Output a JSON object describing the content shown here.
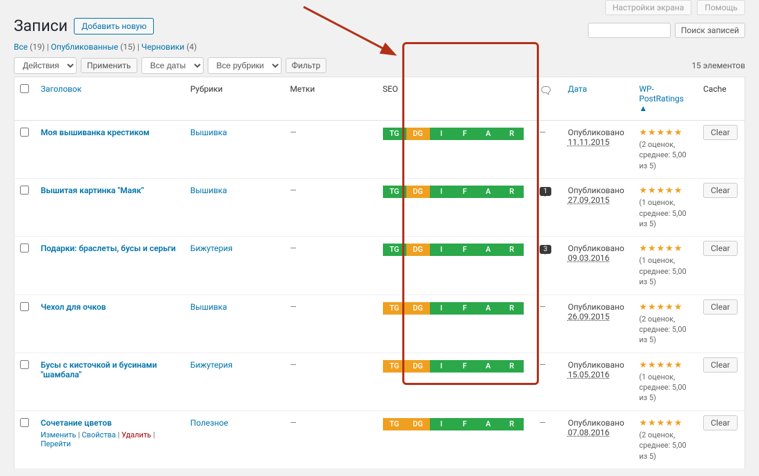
{
  "screen_opts": "Настройки экрана",
  "help": "Помощь",
  "page_title": "Записи",
  "add_new": "Добавить новую",
  "views": {
    "all_label": "Все",
    "all_count": "(19)",
    "pub_label": "Опубликованные",
    "pub_count": "(15)",
    "draft_label": "Черновики",
    "draft_count": "(4)"
  },
  "search": {
    "placeholder": "",
    "btn": "Поиск записей"
  },
  "bulk": {
    "actions": "Действия",
    "apply": "Применить"
  },
  "filters": {
    "all_dates": "Все даты",
    "all_cats": "Все рубрики",
    "filter": "Фильтр"
  },
  "count_items": "15 элементов",
  "columns": {
    "title": "Заголовок",
    "cats": "Рубрики",
    "tags": "Метки",
    "seo": "SEO",
    "date": "Дата",
    "ratings": "WP-PostRatings",
    "cache": "Cache"
  },
  "seo_labels": [
    "TG",
    "DG",
    "I",
    "F",
    "A",
    "R"
  ],
  "pub_text": "Опубликовано",
  "clear": "Clear",
  "row_actions": {
    "edit": "Изменить",
    "props": "Свойства",
    "del": "Удалить",
    "view": "Перейти"
  },
  "rows": [
    {
      "title": "Моя вышиванка крестиком",
      "cat": "Вышивка",
      "seo_colors": [
        "green",
        "orange",
        "green",
        "green",
        "green",
        "green"
      ],
      "comments": "",
      "date": "11.11.2015",
      "rating": "(2 оценок, среднее: 5,00 из 5)"
    },
    {
      "title": "Вышитая картинка \"Маяк\"",
      "cat": "Вышивка",
      "seo_colors": [
        "green",
        "orange",
        "green",
        "green",
        "green",
        "green"
      ],
      "comments": "1",
      "date": "27.09.2015",
      "rating": "(1 оценок, среднее: 5,00 из 5)"
    },
    {
      "title": "Подарки: браслеты, бусы и серьги",
      "cat": "Бижутерия",
      "seo_colors": [
        "green",
        "orange",
        "green",
        "green",
        "green",
        "green"
      ],
      "comments": "3",
      "date": "09.03.2016",
      "rating": "(1 оценок, среднее: 5,00 из 5)"
    },
    {
      "title": "Чехол для очков",
      "cat": "Вышивка",
      "seo_colors": [
        "orange",
        "orange",
        "green",
        "green",
        "green",
        "green"
      ],
      "comments": "",
      "date": "26.09.2015",
      "rating": "(2 оценок, среднее: 5,00 из 5)"
    },
    {
      "title": "Бусы с кисточкой и бусинами \"шамбала\"",
      "cat": "Бижутерия",
      "seo_colors": [
        "orange",
        "orange",
        "green",
        "green",
        "green",
        "green"
      ],
      "comments": "",
      "date": "15.05.2016",
      "rating": "(1 оценок, среднее: 5,00 из 5)"
    },
    {
      "title": "Сочетание цветов",
      "cat": "Полезное",
      "seo_colors": [
        "orange",
        "orange",
        "green",
        "green",
        "green",
        "green"
      ],
      "comments": "",
      "date": "07.08.2016",
      "rating": "(2 оценок, среднее: 5,00 из 5)",
      "show_actions": true
    }
  ]
}
